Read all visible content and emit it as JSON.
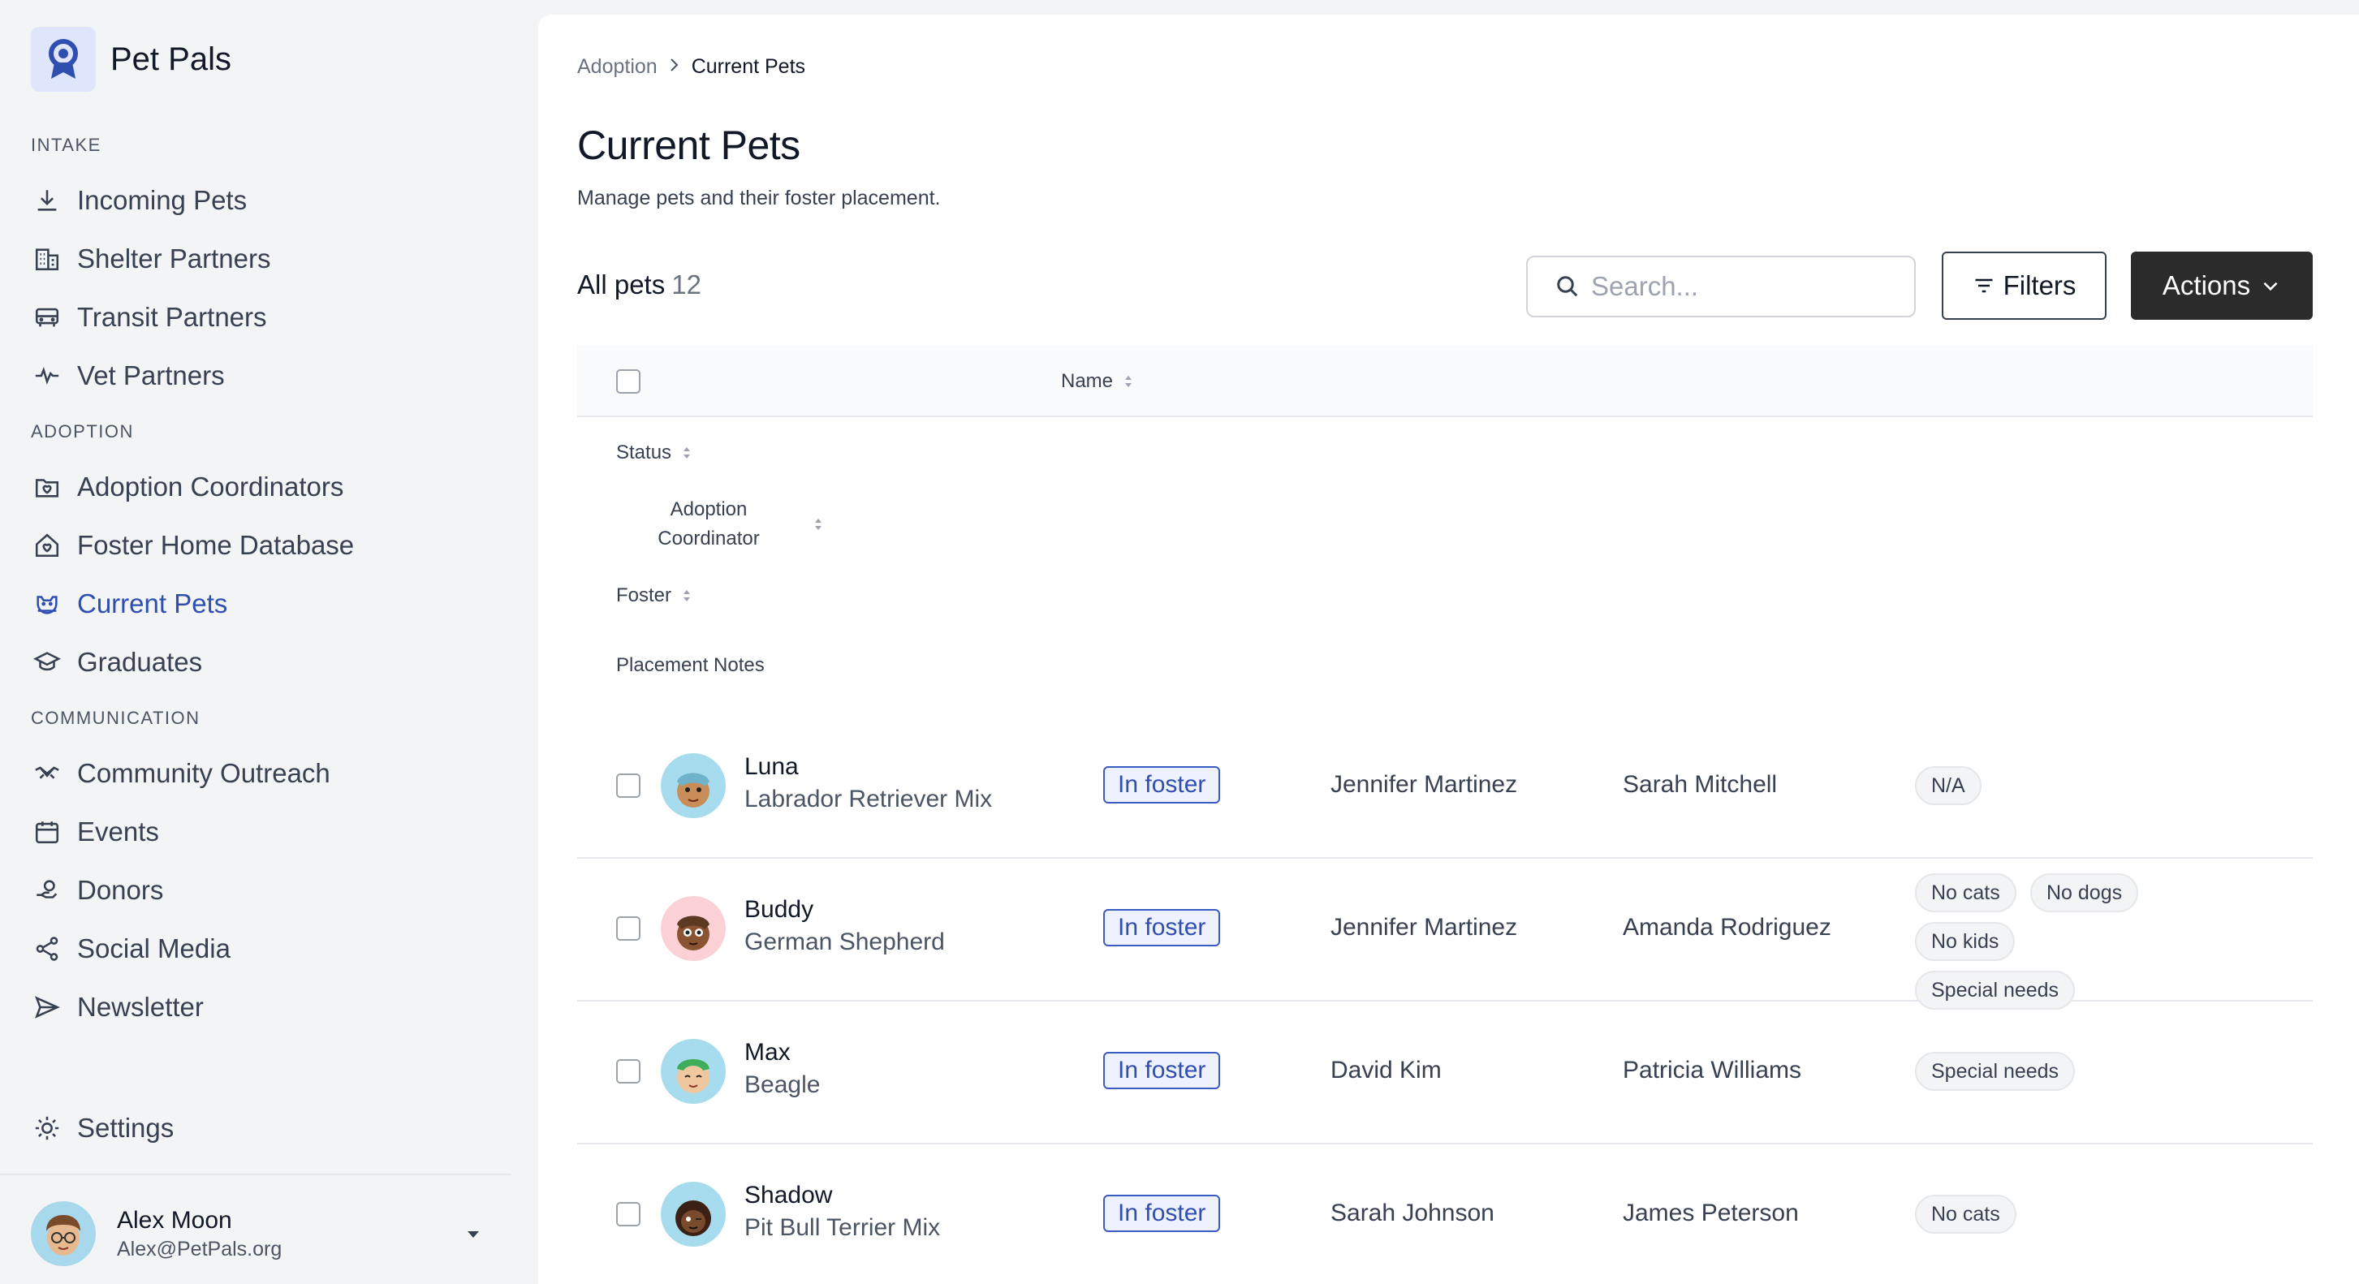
{
  "app": {
    "name": "Pet Pals"
  },
  "sidebar": {
    "sections": [
      {
        "label": "INTAKE",
        "items": [
          {
            "label": "Incoming Pets",
            "icon": "download-icon"
          },
          {
            "label": "Shelter Partners",
            "icon": "building-icon"
          },
          {
            "label": "Transit Partners",
            "icon": "bus-icon"
          },
          {
            "label": "Vet Partners",
            "icon": "heartbeat-icon"
          }
        ]
      },
      {
        "label": "ADOPTION",
        "items": [
          {
            "label": "Adoption Coordinators",
            "icon": "folder-heart-icon"
          },
          {
            "label": "Foster Home Database",
            "icon": "home-heart-icon"
          },
          {
            "label": "Current Pets",
            "icon": "dog-icon",
            "active": true
          },
          {
            "label": "Graduates",
            "icon": "graduation-cap-icon"
          }
        ]
      },
      {
        "label": "COMMUNICATION",
        "items": [
          {
            "label": "Community Outreach",
            "icon": "handshake-icon"
          },
          {
            "label": "Events",
            "icon": "calendar-icon"
          },
          {
            "label": "Donors",
            "icon": "hand-coin-icon"
          },
          {
            "label": "Social Media",
            "icon": "share-icon"
          },
          {
            "label": "Newsletter",
            "icon": "send-icon"
          }
        ]
      }
    ],
    "settings": "Settings",
    "user": {
      "name": "Alex Moon",
      "email": "Alex@PetPals.org"
    }
  },
  "breadcrumb": {
    "parent": "Adoption",
    "current": "Current Pets"
  },
  "page": {
    "title": "Current Pets",
    "subtitle": "Manage pets and their foster placement.",
    "count_label": "All pets",
    "count": "12"
  },
  "toolbar": {
    "search_placeholder": "Search...",
    "filters_label": "Filters",
    "actions_label": "Actions"
  },
  "table": {
    "columns": {
      "name": "Name",
      "status": "Status",
      "coordinator_line1": "Adoption",
      "coordinator_line2": "Coordinator",
      "foster": "Foster",
      "notes": "Placement Notes"
    },
    "rows": [
      {
        "name": "Luna",
        "breed": "Labrador Retriever Mix",
        "status": "In foster",
        "coordinator": "Jennifer Martinez",
        "foster": "Sarah Mitchell",
        "notes": [
          "N/A"
        ],
        "avatar_color": "#a7dcef"
      },
      {
        "name": "Buddy",
        "breed": "German Shepherd",
        "status": "In foster",
        "coordinator": "Jennifer Martinez",
        "foster": "Amanda Rodriguez",
        "notes": [
          "No cats",
          "No dogs",
          "No kids",
          "Special needs"
        ],
        "avatar_color": "#fbd1d6"
      },
      {
        "name": "Max",
        "breed": "Beagle",
        "status": "In foster",
        "coordinator": "David Kim",
        "foster": "Patricia Williams",
        "notes": [
          "Special needs"
        ],
        "avatar_color": "#a7dcef"
      },
      {
        "name": "Shadow",
        "breed": "Pit Bull Terrier Mix",
        "status": "In foster",
        "coordinator": "Sarah Johnson",
        "foster": "James Peterson",
        "notes": [
          "No cats"
        ],
        "avatar_color": "#a7dcef"
      }
    ]
  }
}
